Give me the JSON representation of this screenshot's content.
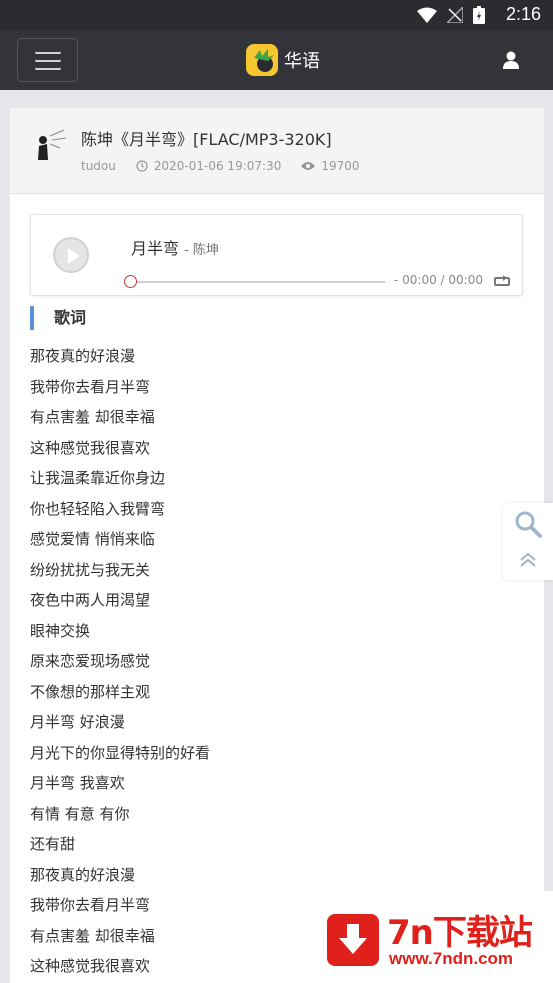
{
  "status_bar": {
    "time": "2:16"
  },
  "header": {
    "brand": "华语"
  },
  "post": {
    "title": "陈坤《月半弯》[FLAC/MP3-320K]",
    "author": "tudou",
    "datetime": "2020-01-06 19:07:30",
    "views": "19700"
  },
  "player": {
    "song": "月半弯",
    "artist": "- 陈坤",
    "time": "- 00:00 / 00:00"
  },
  "lyrics": {
    "heading": "歌词",
    "lines": [
      "那夜真的好浪漫",
      "我带你去看月半弯",
      "有点害羞 却很幸福",
      "这种感觉我很喜欢",
      "让我温柔靠近你身边",
      "你也轻轻陷入我臂弯",
      "感觉爱情 悄悄来临",
      "纷纷扰扰与我无关",
      "夜色中两人用渴望",
      "眼神交换",
      "原来恋爱现场感觉",
      "不像想的那样主观",
      "月半弯 好浪漫",
      "月光下的你显得特别的好看",
      "月半弯 我喜欢",
      "有情 有意 有你",
      "还有甜",
      "那夜真的好浪漫",
      "我带你去看月半弯",
      "有点害羞 却很幸福",
      "这种感觉我很喜欢"
    ]
  },
  "watermark": {
    "name": "7n下载站",
    "url": "www.7ndn.com"
  },
  "icons": [
    "wifi-icon",
    "signal-icon",
    "battery-icon",
    "menu-icon",
    "user-icon",
    "clock-icon",
    "eye-icon",
    "play-icon",
    "loop-icon",
    "search-icon",
    "back-to-top-icon",
    "download-icon"
  ],
  "colors": {
    "header": "#33343a",
    "accent": "#5b8fd8",
    "progress_knob": "#c0392b",
    "watermark": "#e0211b"
  }
}
